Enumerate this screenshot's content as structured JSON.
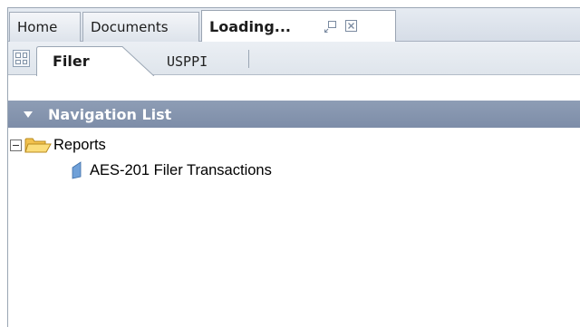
{
  "doc_tabs": {
    "home": "Home",
    "documents": "Documents",
    "loading": "Loading..."
  },
  "sub_tabs": {
    "filer": "Filer",
    "usppi": "USPPI"
  },
  "navigation": {
    "header": "Navigation List",
    "tree": {
      "folder": "Reports",
      "items": [
        "AES-201 Filer Transactions"
      ]
    }
  }
}
